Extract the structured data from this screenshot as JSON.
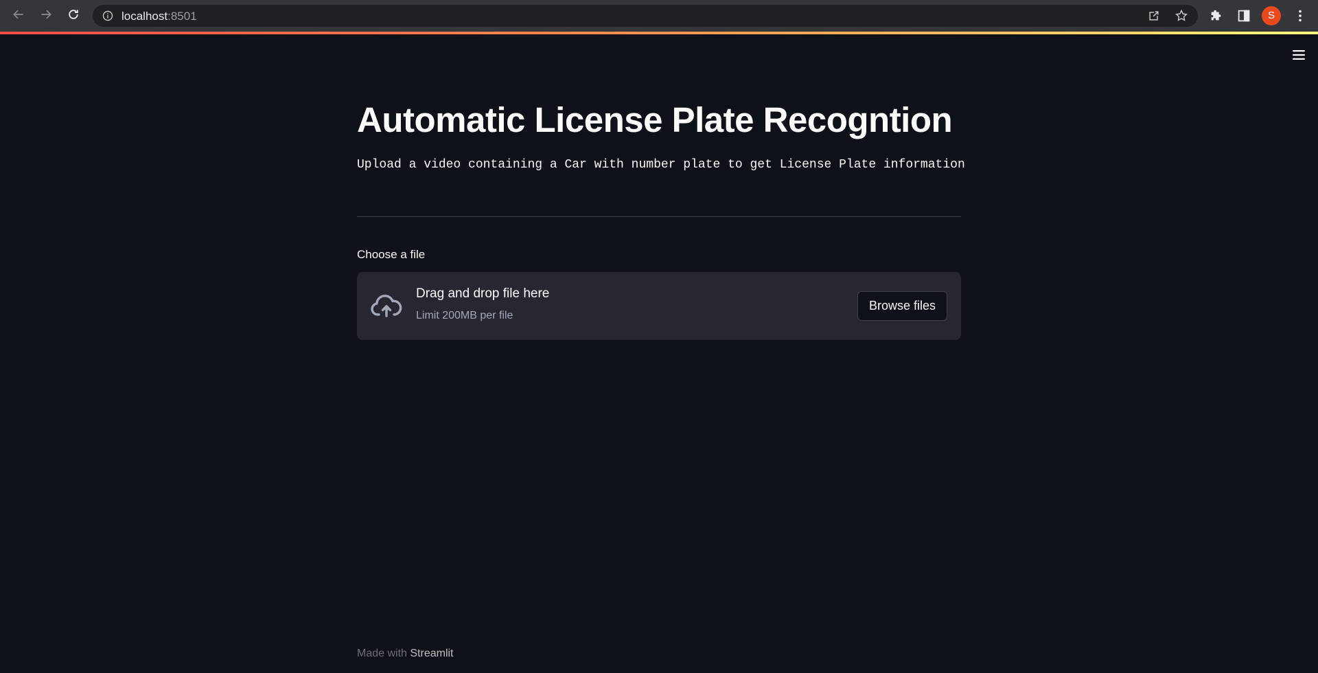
{
  "browser": {
    "url_host": "localhost",
    "url_port": ":8501",
    "avatar_initial": "S",
    "icons": {
      "back": "arrow-left-icon",
      "forward": "arrow-right-icon",
      "reload": "reload-icon",
      "site_info": "info-icon",
      "share": "share-icon",
      "bookmark": "star-icon",
      "extensions": "puzzle-icon",
      "side_panel": "side-panel-icon",
      "menu": "kebab-menu-icon"
    }
  },
  "app": {
    "title": "Automatic License Plate Recogntion",
    "subtitle": "Upload a video containing a Car with number plate to get License Plate information",
    "uploader": {
      "label": "Choose a file",
      "drop_text": "Drag and drop file here",
      "limit_text": "Limit 200MB per file",
      "browse_label": "Browse files",
      "icon": "cloud-upload-icon"
    },
    "footer": {
      "prefix": "Made with",
      "brand": "Streamlit"
    },
    "menu_icon": "hamburger-menu-icon"
  },
  "colors": {
    "background": "#0e1117",
    "secondary_background": "#262730",
    "text": "#fafafa",
    "muted_text": "#a3a8b8",
    "avatar": "#e8491d",
    "stripe_start": "#ff4b4b",
    "stripe_end": "#fffd80"
  }
}
